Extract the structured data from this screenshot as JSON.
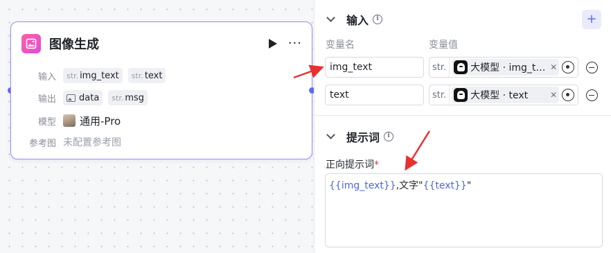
{
  "node": {
    "title": "图像生成",
    "rows": {
      "input_label": "输入",
      "inputs": [
        {
          "type": "str.",
          "name": "img_text"
        },
        {
          "type": "str.",
          "name": "text"
        }
      ],
      "output_label": "输出",
      "outputs": [
        {
          "type": "image",
          "name": "data"
        },
        {
          "type": "str.",
          "name": "msg"
        }
      ],
      "model_label": "模型",
      "model_value": "通用-Pro",
      "ref_label": "参考图",
      "ref_value": "未配置参考图"
    }
  },
  "panel": {
    "input_section": {
      "title": "输入",
      "add_label": "+",
      "col_name": "变量名",
      "col_value": "变量值",
      "variables": [
        {
          "name": "img_text",
          "type": "str.",
          "ref": "大模型 · img_t…"
        },
        {
          "name": "text",
          "type": "str.",
          "ref": "大模型 · text"
        }
      ]
    },
    "prompt_section": {
      "title": "提示词",
      "positive_label": "正向提示词",
      "required_mark": "*",
      "prompt": {
        "var1": "{{img_text}}",
        "mid": ",文字\"",
        "var2": "{{text}}",
        "end": "\""
      }
    }
  },
  "colors": {
    "accent": "#5b6cf0",
    "node_border": "#9a8cf5",
    "annotation_arrow": "#e8302f",
    "variable_ref": "#4a66e8"
  }
}
